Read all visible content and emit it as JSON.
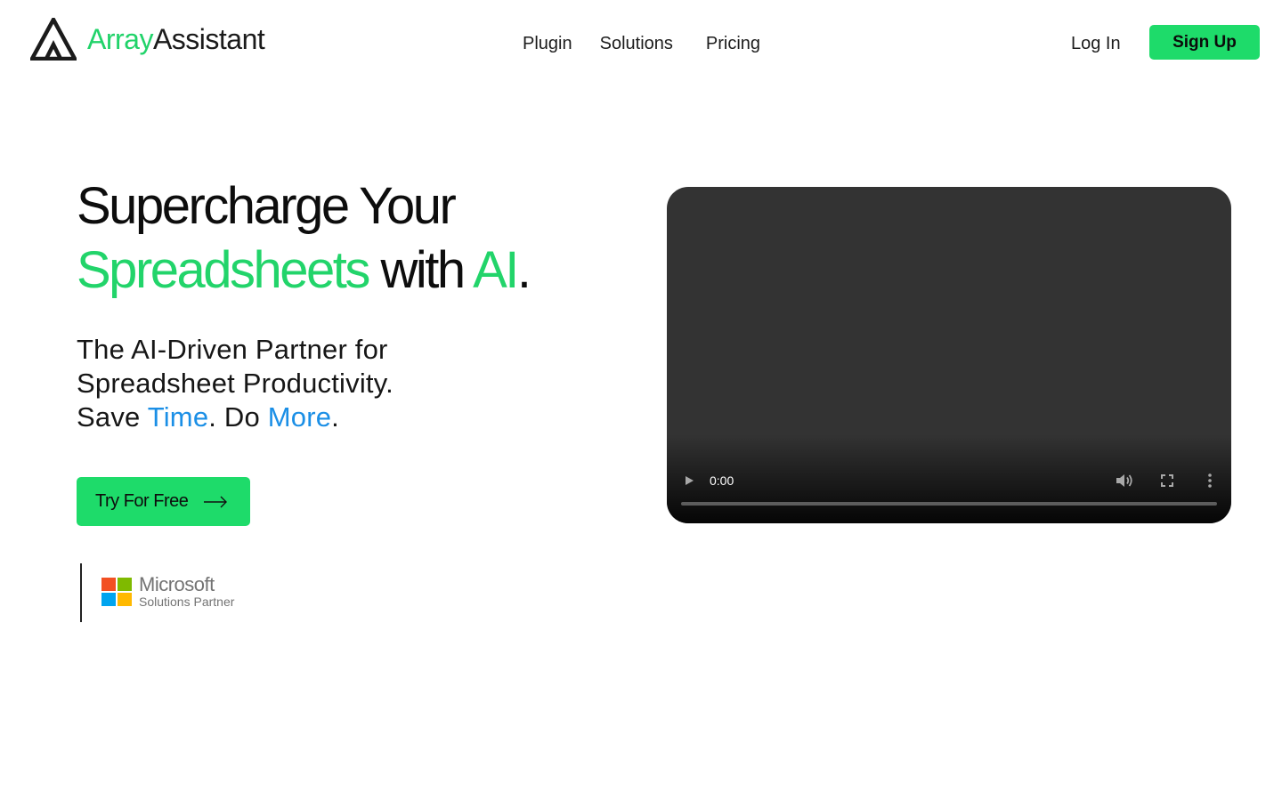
{
  "brand": {
    "name_part1": "Array",
    "name_part2": "Assistant",
    "accent_color": "#21d36a",
    "logo_icon": "triangle-a-logo-icon"
  },
  "nav": {
    "items": [
      {
        "label": "Plugin"
      },
      {
        "label": "Solutions"
      },
      {
        "label": "Pricing"
      }
    ]
  },
  "auth": {
    "login_label": "Log In",
    "signup_label": "Sign Up"
  },
  "hero": {
    "headline": {
      "line1": "Supercharge Your",
      "word_spreadsheets": "Spreadsheets",
      "word_with": " with ",
      "word_ai": "AI",
      "period": "."
    },
    "subtitle": {
      "line1": "The AI-Driven Partner for",
      "line2": "Spreadsheet Productivity.",
      "save": "Save ",
      "time": "Time",
      "do": ". Do ",
      "more": "More",
      "period": "."
    },
    "highlight_color": "#1b8fe6",
    "cta_label": "Try For Free",
    "cta_icon": "arrow-right-icon"
  },
  "partner_badge": {
    "name": "Microsoft",
    "subtitle": "Solutions Partner",
    "colors": [
      "#f25022",
      "#7fba00",
      "#00a4ef",
      "#ffb900"
    ]
  },
  "video": {
    "current_time": "0:00",
    "progress": 0,
    "controls": [
      "play-icon",
      "volume-icon",
      "fullscreen-icon",
      "more-options-icon"
    ]
  }
}
